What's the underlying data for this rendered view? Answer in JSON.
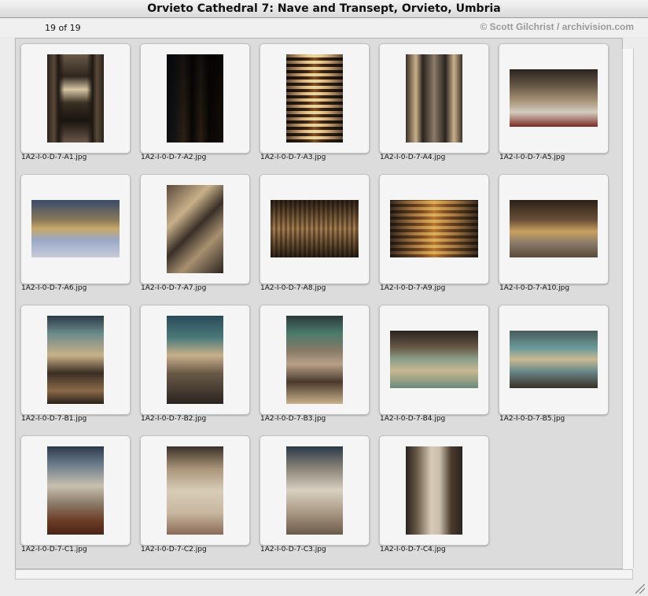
{
  "window": {
    "title": "Orvieto Cathedral 7: Nave and Transept, Orvieto, Umbria"
  },
  "header": {
    "count": "19 of 19",
    "credit": "© Scott Gilchrist / archivision.com"
  },
  "thumbnails": [
    {
      "filename": "1A2-I-0-D-7-A1.jpg"
    },
    {
      "filename": "1A2-I-0-D-7-A2.jpg"
    },
    {
      "filename": "1A2-I-0-D-7-A3.jpg"
    },
    {
      "filename": "1A2-I-0-D-7-A4.jpg"
    },
    {
      "filename": "1A2-I-0-D-7-A5.jpg"
    },
    {
      "filename": "1A2-I-0-D-7-A6.jpg"
    },
    {
      "filename": "1A2-I-0-D-7-A7.jpg"
    },
    {
      "filename": "1A2-I-0-D-7-A8.jpg"
    },
    {
      "filename": "1A2-I-0-D-7-A9.jpg"
    },
    {
      "filename": "1A2-I-0-D-7-A10.jpg"
    },
    {
      "filename": "1A2-I-0-D-7-B1.jpg"
    },
    {
      "filename": "1A2-I-0-D-7-B2.jpg"
    },
    {
      "filename": "1A2-I-0-D-7-B3.jpg"
    },
    {
      "filename": "1A2-I-0-D-7-B4.jpg"
    },
    {
      "filename": "1A2-I-0-D-7-B5.jpg"
    },
    {
      "filename": "1A2-I-0-D-7-C1.jpg"
    },
    {
      "filename": "1A2-I-0-D-7-C2.jpg"
    },
    {
      "filename": "1A2-I-0-D-7-C3.jpg"
    },
    {
      "filename": "1A2-I-0-D-7-C4.jpg"
    }
  ]
}
